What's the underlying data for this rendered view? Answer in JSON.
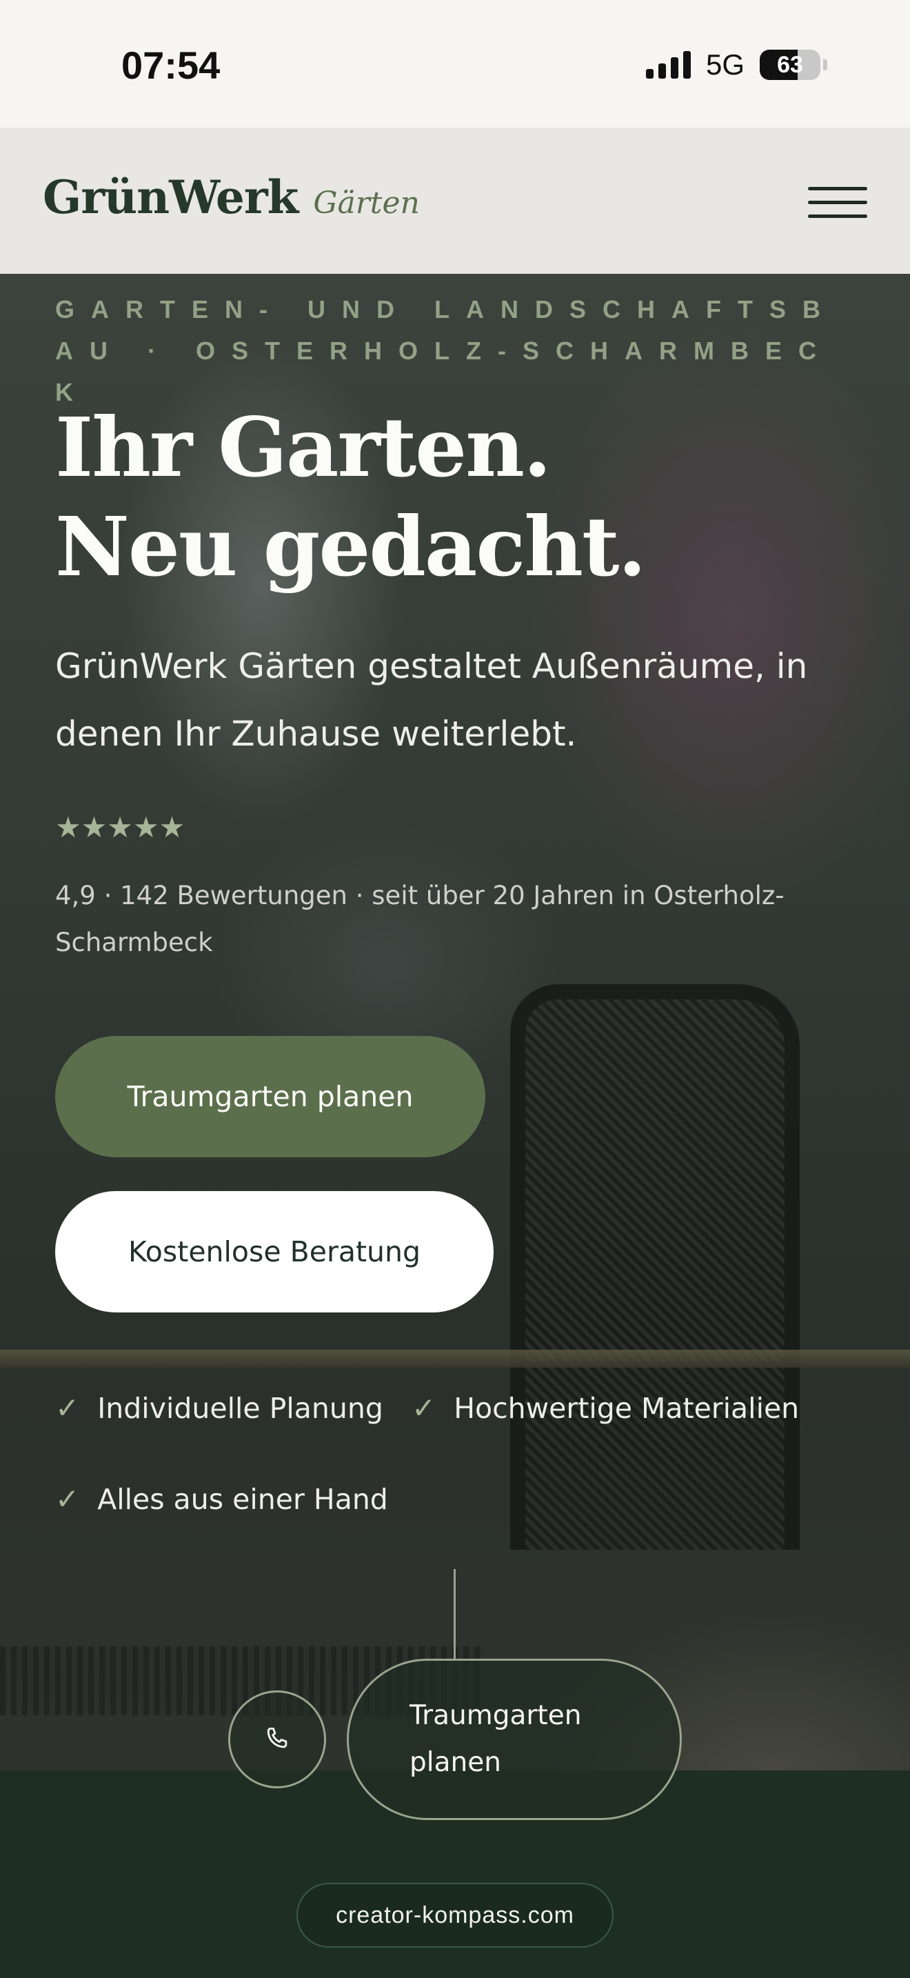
{
  "status_bar": {
    "time": "07:54",
    "network": "5G",
    "battery": "63",
    "battery_level": 0.63
  },
  "header": {
    "logo_main": "GrünWerk",
    "logo_sub": "Gärten",
    "menu_icon": "hamburger-menu-icon"
  },
  "hero": {
    "eyebrow": "GARTEN- UND LANDSCHAFTSBAU · OSTERHOLZ-SCHARMBECK",
    "title_line1": "Ihr Garten.",
    "title_line2": "Neu gedacht.",
    "subtitle": "GrünWerk Gärten gestaltet Außenräume, in denen Ihr Zuhause weiterlebt.",
    "stars": "★★★★★",
    "rating_value": 5,
    "rating_text": "4,9 · 142 Bewertungen · seit über 20 Jahren in Osterholz-Scharmbeck",
    "primary_button": "Traumgarten planen",
    "secondary_button": "Kostenlose Beratung",
    "features": [
      "Individuelle Planung",
      "Hochwertige Materialien",
      "Alles aus einer Hand"
    ],
    "check_symbol": "✓"
  },
  "bottom_bar": {
    "call_icon": "phone-icon",
    "cta_label": "Traumgarten planen",
    "domain": "creator-kompass.com"
  },
  "colors": {
    "brand_green": "#5c6f4d",
    "dark_green": "#1f2e23",
    "accent_sage": "#a6b497"
  }
}
